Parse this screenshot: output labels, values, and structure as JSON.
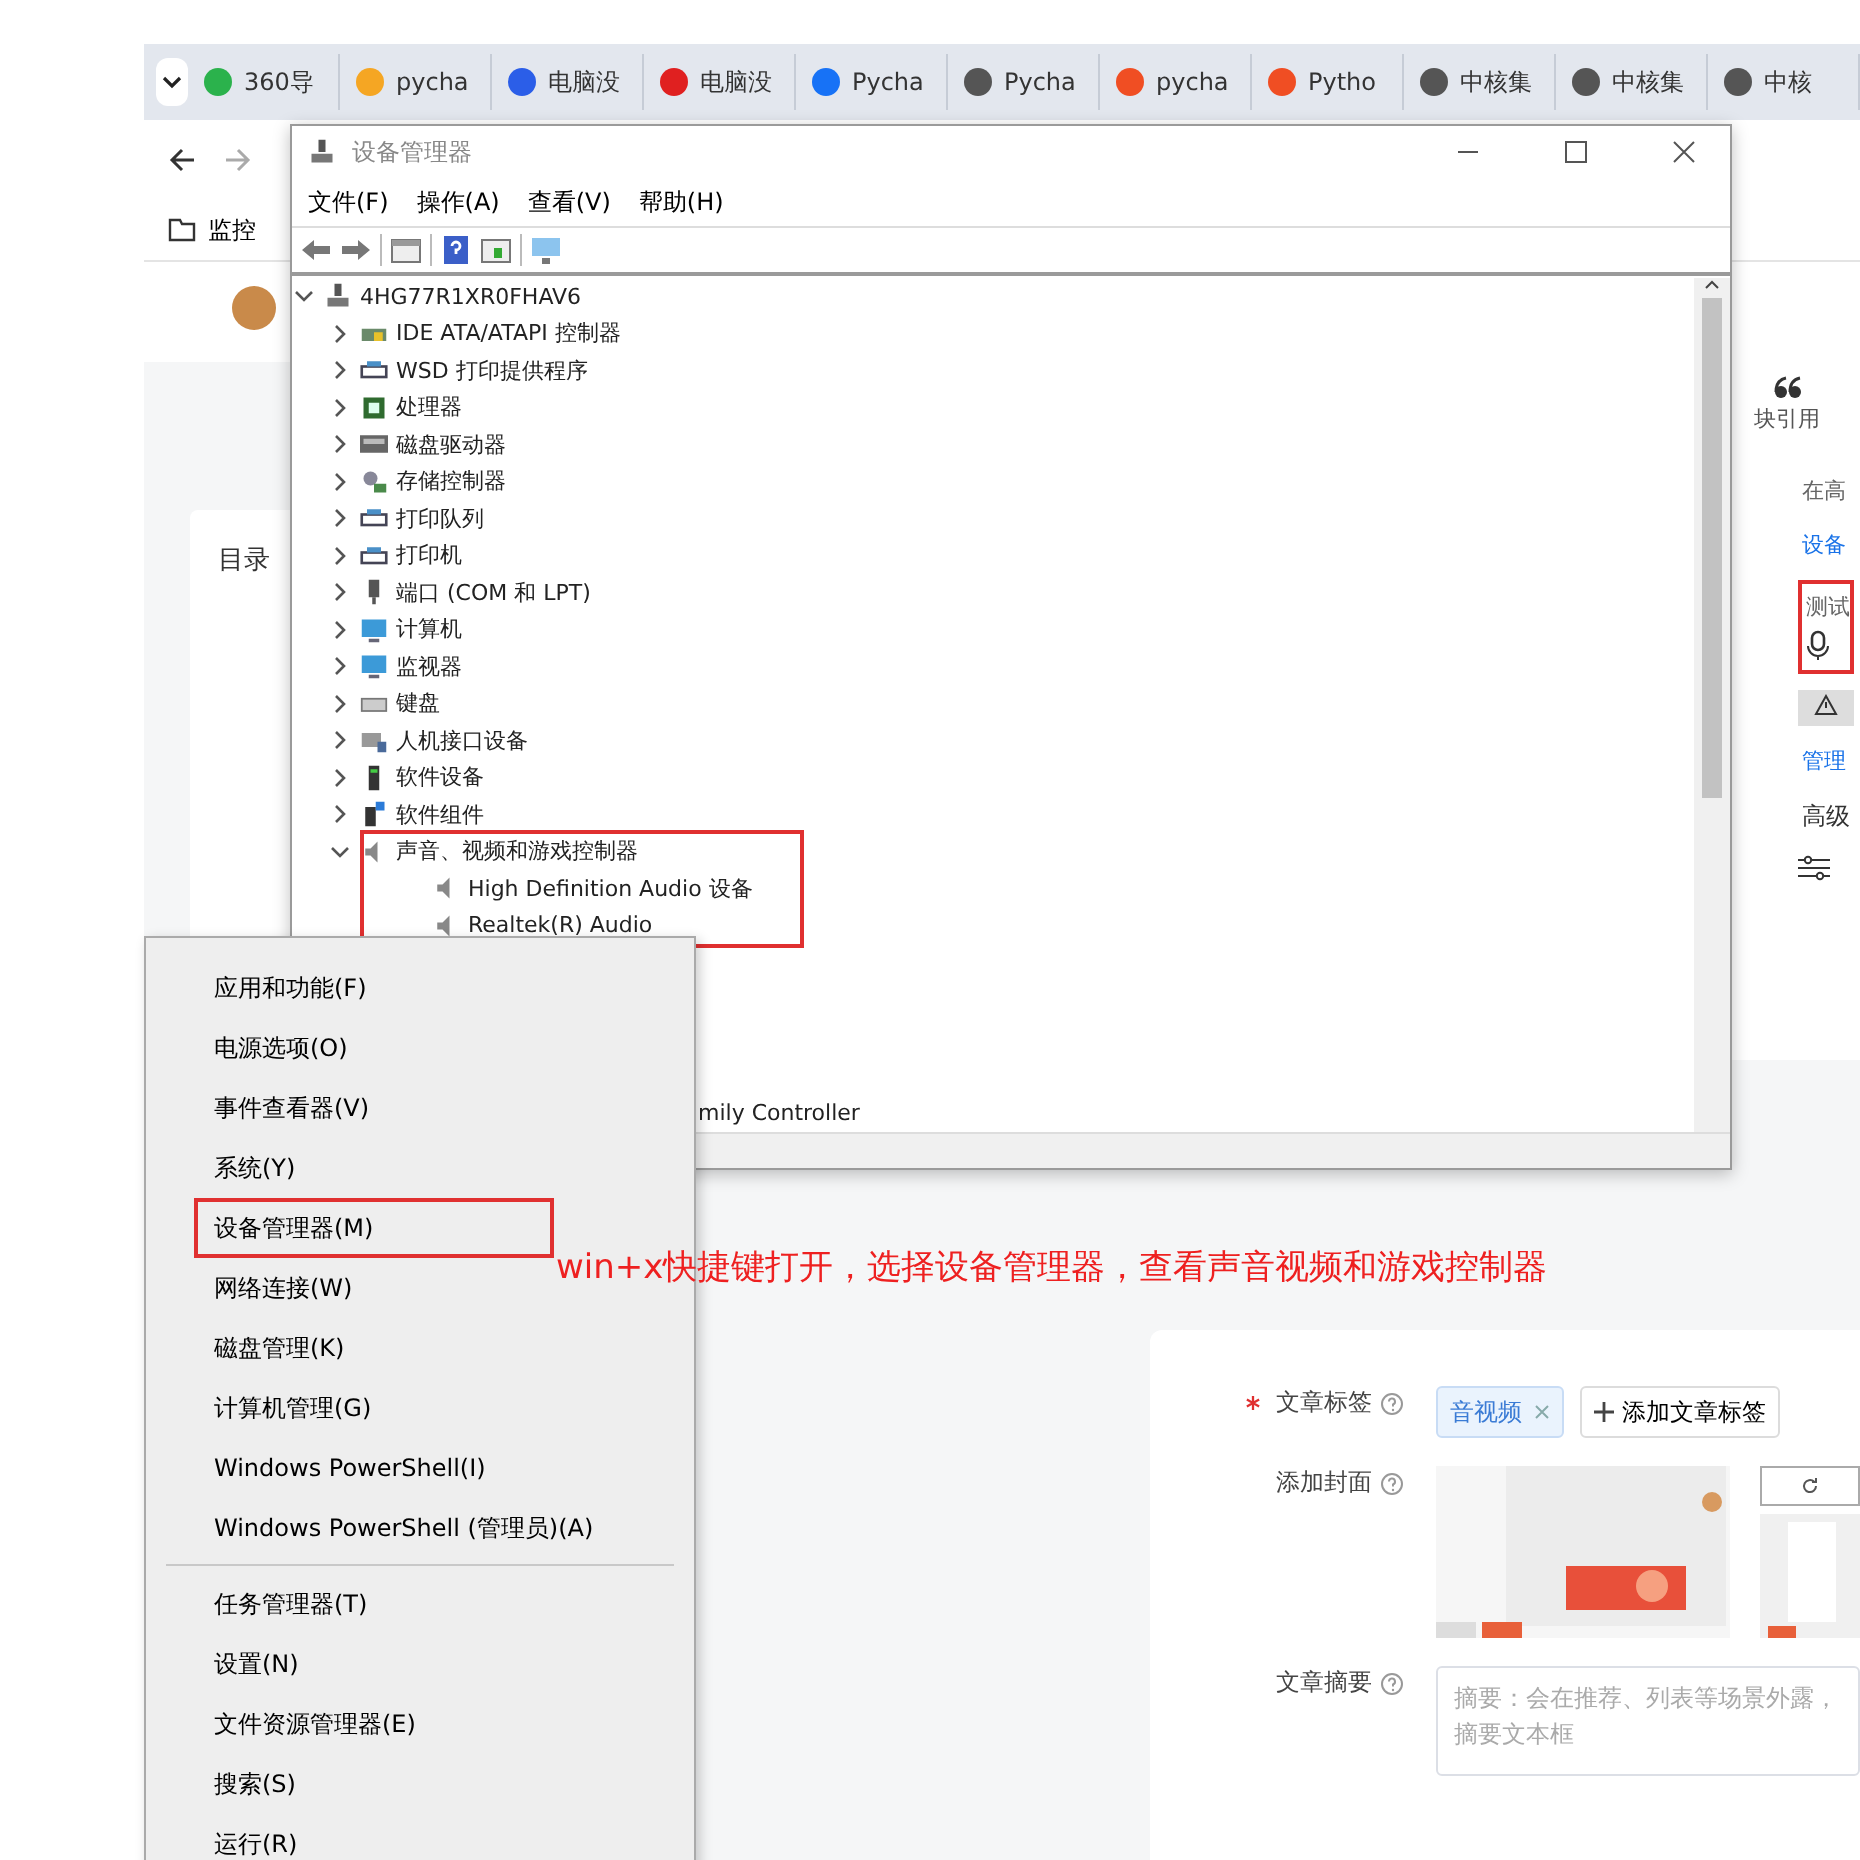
{
  "browser": {
    "tabs": [
      {
        "label": "360导",
        "selected": false
      },
      {
        "label": "pycha",
        "selected": false
      },
      {
        "label": "电脑没",
        "selected": false
      },
      {
        "label": "电脑没",
        "selected": false
      },
      {
        "label": "Pycha",
        "selected": false
      },
      {
        "label": "Pycha",
        "selected": false
      },
      {
        "label": "pycha",
        "selected": false
      },
      {
        "label": "Pytho",
        "selected": false
      },
      {
        "label": "中核集",
        "selected": false
      },
      {
        "label": "中核集",
        "selected": false
      },
      {
        "label": "中核",
        "selected": false
      }
    ],
    "bookmarks": [
      {
        "label": "监控"
      }
    ]
  },
  "article_page": {
    "toc_title": "目录",
    "toolbar_item": "块引用",
    "side_items": [
      {
        "text": "在高",
        "kind": "text",
        "highlighted": false
      },
      {
        "text": "设备",
        "kind": "link",
        "highlighted": false
      },
      {
        "text": "测试",
        "kind": "test",
        "highlighted": true
      },
      {
        "text": "管理",
        "kind": "link",
        "highlighted": false
      },
      {
        "text": "高级",
        "kind": "heading",
        "highlighted": false
      }
    ],
    "form": [
      {
        "label": "文章标签",
        "required": true,
        "kind": "tags",
        "tags": [
          "音视频"
        ],
        "add_button": "添加文章标签"
      },
      {
        "label": "添加封面",
        "required": false,
        "kind": "cover"
      },
      {
        "label": "文章摘要",
        "required": false,
        "kind": "summary",
        "placeholder": "摘要：会在推荐、列表等场景外露，摘要文本框"
      }
    ]
  },
  "device_manager": {
    "title": "设备管理器",
    "menus": [
      "文件(F)",
      "操作(A)",
      "查看(V)",
      "帮助(H)"
    ],
    "tree": {
      "label": "4HG77R1XR0FHAV6",
      "expanded": true,
      "highlighted": false,
      "children": [
        {
          "label": "IDE ATA/ATAPI 控制器",
          "expanded": false,
          "highlighted": false
        },
        {
          "label": "WSD 打印提供程序",
          "expanded": false,
          "highlighted": false
        },
        {
          "label": "处理器",
          "expanded": false,
          "highlighted": false
        },
        {
          "label": "磁盘驱动器",
          "expanded": false,
          "highlighted": false
        },
        {
          "label": "存储控制器",
          "expanded": false,
          "highlighted": false
        },
        {
          "label": "打印队列",
          "expanded": false,
          "highlighted": false
        },
        {
          "label": "打印机",
          "expanded": false,
          "highlighted": false
        },
        {
          "label": "端口 (COM 和 LPT)",
          "expanded": false,
          "highlighted": false
        },
        {
          "label": "计算机",
          "expanded": false,
          "highlighted": false
        },
        {
          "label": "监视器",
          "expanded": false,
          "highlighted": false
        },
        {
          "label": "键盘",
          "expanded": false,
          "highlighted": false
        },
        {
          "label": "人机接口设备",
          "expanded": false,
          "highlighted": false
        },
        {
          "label": "软件设备",
          "expanded": false,
          "highlighted": false
        },
        {
          "label": "软件组件",
          "expanded": false,
          "highlighted": false
        },
        {
          "label": "声音、视频和游戏控制器",
          "expanded": true,
          "highlighted": true,
          "children": [
            {
              "label": "High Definition Audio 设备"
            },
            {
              "label": "Realtek(R) Audio"
            }
          ]
        }
      ]
    },
    "partial_row": "mily Controller"
  },
  "context_menu": {
    "groups": [
      [
        {
          "label": "应用和功能(F)",
          "highlighted": false
        },
        {
          "label": "电源选项(O)",
          "highlighted": false
        },
        {
          "label": "事件查看器(V)",
          "highlighted": false
        },
        {
          "label": "系统(Y)",
          "highlighted": false
        },
        {
          "label": "设备管理器(M)",
          "highlighted": true
        },
        {
          "label": "网络连接(W)",
          "highlighted": false
        },
        {
          "label": "磁盘管理(K)",
          "highlighted": false
        },
        {
          "label": "计算机管理(G)",
          "highlighted": false
        },
        {
          "label": "Windows PowerShell(I)",
          "highlighted": false
        },
        {
          "label": "Windows PowerShell (管理员)(A)",
          "highlighted": false
        }
      ],
      [
        {
          "label": "任务管理器(T)",
          "highlighted": false
        },
        {
          "label": "设置(N)",
          "highlighted": false
        },
        {
          "label": "文件资源管理器(E)",
          "highlighted": false
        },
        {
          "label": "搜索(S)",
          "highlighted": false
        },
        {
          "label": "运行(R)",
          "highlighted": false
        }
      ]
    ]
  },
  "annotation": "win+x快捷键打开，选择设备管理器，查看声音视频和游戏控制器"
}
